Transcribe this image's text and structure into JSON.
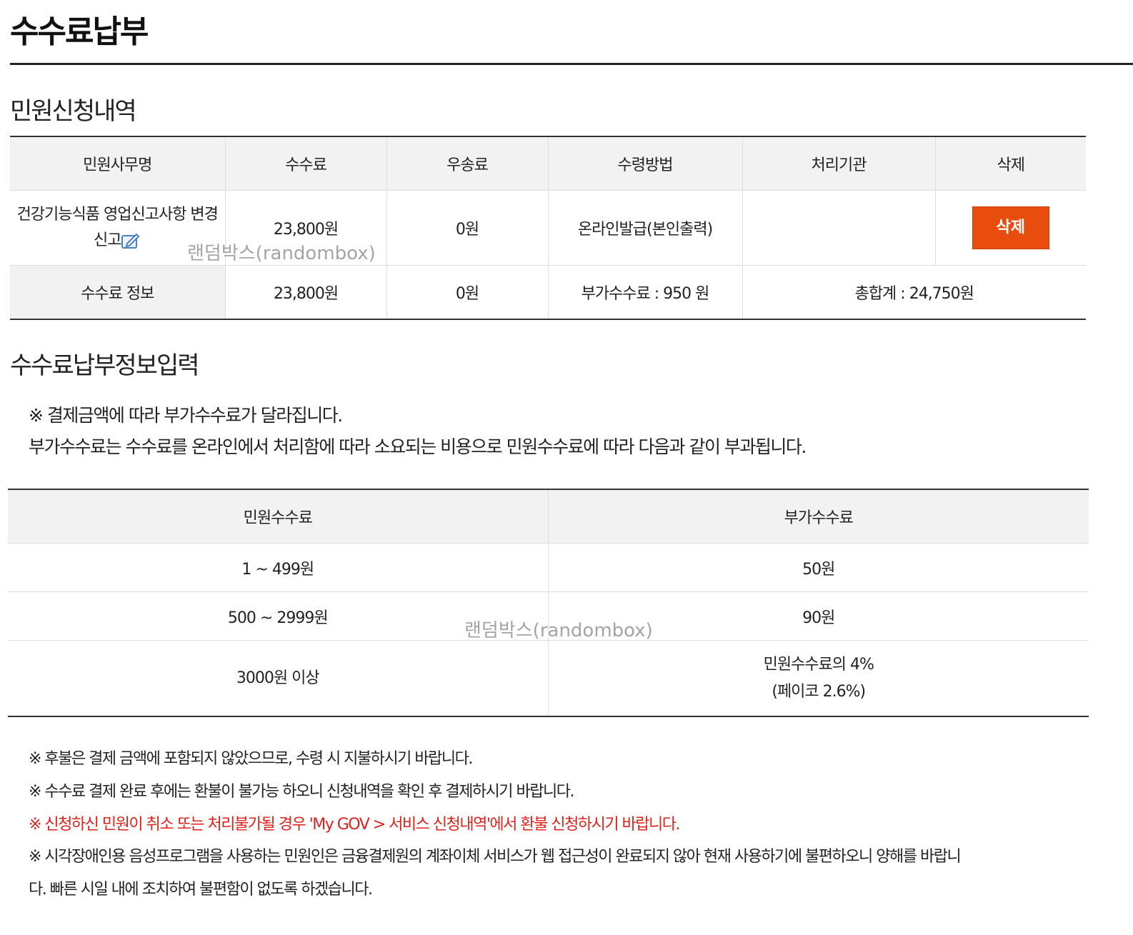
{
  "page_title": "수수료납부",
  "apply_section": {
    "title": "민원신청내역",
    "headers": [
      "민원사무명",
      "수수료",
      "우송료",
      "수령방법",
      "처리기관",
      "삭제"
    ],
    "row": {
      "task_name": "건강기능식품 영업신고사항 변경신고",
      "fee": "23,800원",
      "postage": "0원",
      "receipt_method": "온라인발급(본인출력)",
      "agency": "",
      "delete_label": "삭제"
    },
    "summary": {
      "label": "수수료 정보",
      "fee": "23,800원",
      "postage": "0원",
      "extra_fee": "부가수수료 : 950 원",
      "total": "총합계 : 24,750원"
    }
  },
  "payment_section": {
    "title": "수수료납부정보입력",
    "notice_line1": "※ 결제금액에 따라 부가수수료가 달라집니다.",
    "notice_line2": "부가수수료는 수수료를 온라인에서 처리함에 따라 소요되는 비용으로 민원수수료에 따라 다음과 같이 부과됩니다.",
    "fee_table": {
      "headers": [
        "민원수수료",
        "부가수수료"
      ],
      "rows": [
        [
          "1 ~ 499원",
          "50원"
        ],
        [
          "500 ~ 2999원",
          "90원"
        ],
        [
          "3000원 이상",
          "민원수수료의 4%",
          "(페이코 2.6%)"
        ]
      ]
    }
  },
  "footnotes": {
    "line1": "※ 후불은 결제 금액에 포함되지 않았으므로, 수령 시 지불하시기 바랍니다.",
    "line2": "※ 수수료 결제 완료 후에는 환불이 불가능 하오니 신청내역을 확인 후 결제하시기 바랍니다.",
    "line3": "※ 신청하신 민원이 취소 또는 처리불가될 경우 'My GOV > 서비스 신청내역'에서 환불 신청하시기 바랍니다.",
    "line4": "※ 시각장애인용 음성프로그램을 사용하는 민원인은 금융결제원의 계좌이체 서비스가 웹 접근성이 완료되지 않아 현재 사용하기에 불편하오니 양해를 바랍니",
    "line5": "다. 빠른 시일 내에 조치하여 불편함이 없도록 하겠습니다."
  },
  "watermark": "랜덤박스(randombox)",
  "colors": {
    "delete_button": "#e84d0e",
    "warning_text": "#e0211a",
    "header_bg": "#f2f2f2"
  }
}
